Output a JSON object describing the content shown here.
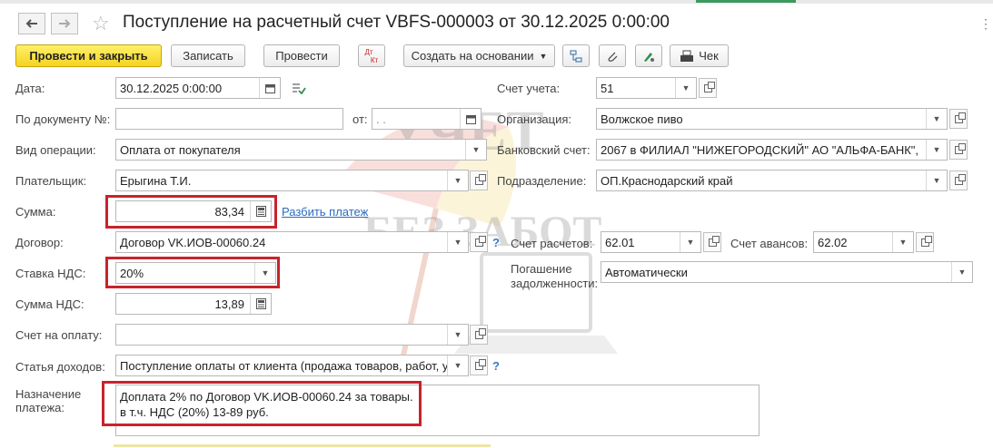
{
  "window": {
    "title": "Поступление на расчетный счет VBFS-000003 от 30.12.2025 0:00:00"
  },
  "toolbar": {
    "post_close": "Провести и закрыть",
    "save": "Записать",
    "post": "Провести",
    "dtkt_top": "Дт",
    "dtkt_bottom": "Кт",
    "create_based": "Создать на основании",
    "receipt": "Чек"
  },
  "watermark": {
    "line1": "УЧЕТ",
    "line2": "БЕЗ ЗАБОТ"
  },
  "form": {
    "date_label": "Дата:",
    "date_value": "30.12.2025  0:00:00",
    "doc_label": "По документу №:",
    "doc_value": "",
    "from_label": "от:",
    "from_value": " .  .",
    "op_label": "Вид операции:",
    "op_value": "Оплата от покупателя",
    "payer_label": "Плательщик:",
    "payer_value": "Ерыгина Т.И.",
    "sum_label": "Сумма:",
    "sum_value": "83,34",
    "split_link": "Разбить платеж",
    "contract_label": "Договор:",
    "contract_value": "Договор VK.ИОВ-00060.24",
    "vat_rate_label": "Ставка НДС:",
    "vat_rate_value": "20%",
    "vat_sum_label": "Сумма НДС:",
    "vat_sum_value": "13,89",
    "invoice_label": "Счет на оплату:",
    "invoice_value": "",
    "income_label": "Статья доходов:",
    "income_value": "Поступление оплаты от клиента (продажа товаров, работ, ус",
    "purpose_label_1": "Назначение",
    "purpose_label_2": "платежа:",
    "purpose_line_1": "Доплата 2% по Договор VK.ИОВ-00060.24 за товары.",
    "purpose_line_2": "в т.ч. НДС (20%) 13-89 руб.",
    "account_label": "Счет учета:",
    "account_value": "51",
    "org_label": "Организация:",
    "org_value": "Волжское пиво",
    "bank_label": "Банковский счет:",
    "bank_value": "2067 в ФИЛИАЛ \"НИЖЕГОРОДСКИЙ\" АО \"АЛЬФА-БАНК\",",
    "division_label": "Подразделение:",
    "division_value": "ОП.Краснодарский край",
    "settle_label": "Счет расчетов:",
    "settle_value": "62.01",
    "advance_label": "Счет авансов:",
    "advance_value": "62.02",
    "repay_label_1": "Погашение",
    "repay_label_2": "задолженности:",
    "repay_value": "Автоматически",
    "help": "?"
  },
  "colors": {
    "primary_button": "#f5d321",
    "highlight_box": "#c8232c",
    "link": "#2a6cbf"
  }
}
